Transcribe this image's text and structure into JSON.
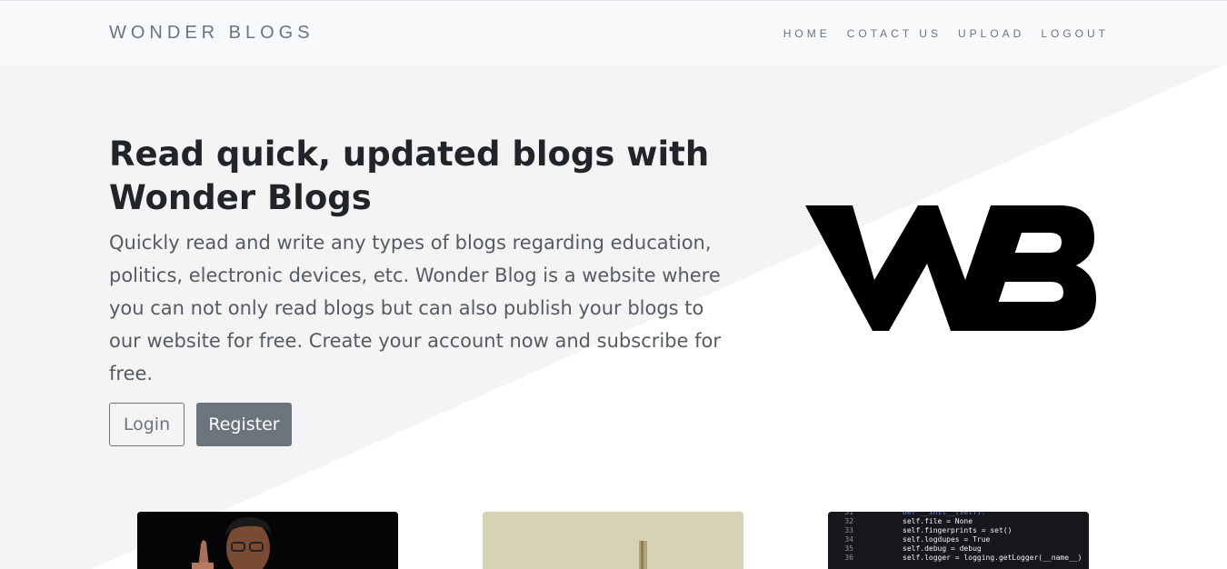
{
  "navbar": {
    "brand": "WONDER BLOGS",
    "links": [
      "HOME",
      "COTACT US",
      "UPLOAD",
      "LOGOUT"
    ]
  },
  "hero": {
    "title_line1": "Read quick, updated blogs with",
    "title_line2": "Wonder Blogs",
    "description": "Quickly read and write any types of blogs regarding education, politics, electronic devices, etc. Wonder Blog is a website where you can not only read blogs but can also publish your blogs to our website for free. Create your account now and subscribe for free.",
    "login_label": "Login",
    "register_label": "Register"
  },
  "logo": {
    "icon": "wb-logo-icon"
  },
  "cards": [
    {
      "image": "speaker-photo"
    },
    {
      "image": "cross-photo"
    },
    {
      "image": "code-screenshot",
      "code": [
        {
          "ln": "31",
          "text": ""
        },
        {
          "ln": "32",
          "text": "self.file = None"
        },
        {
          "ln": "33",
          "text": "self.fingerprints = set()"
        },
        {
          "ln": "34",
          "text": "self.logdupes = True"
        },
        {
          "ln": "35",
          "text": "self.debug = debug"
        },
        {
          "ln": "36",
          "text": "self.logger = logging.getLogger(__name__)"
        }
      ]
    }
  ],
  "colors": {
    "navbar_bg": "#f8f9fa",
    "hero_bg": "#f4f4f4",
    "secondary": "#6c757d",
    "text_dark": "#212529"
  }
}
